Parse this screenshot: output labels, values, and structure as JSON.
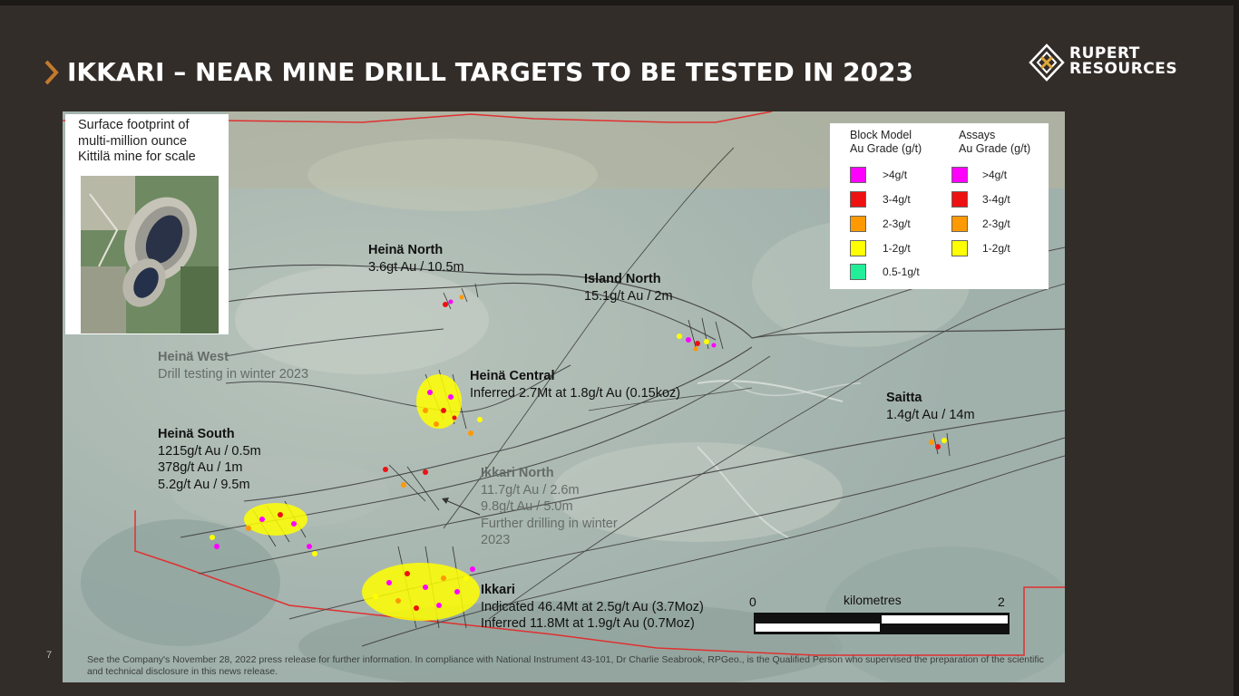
{
  "slide": {
    "title": "IKKARI – NEAR MINE DRILL TARGETS TO BE TESTED IN 2023",
    "page_number": "7",
    "footnote": "See the Company's November 28, 2022 press release for further information. In compliance with National Instrument 43-101, Dr Charlie Seabrook, RPGeo., is the Qualified Person who supervised the preparation of the scientific and technical disclosure in this news release."
  },
  "logo": {
    "line1": "RUPERT",
    "line2": "RESOURCES"
  },
  "inset": {
    "caption_line1": "Surface footprint of",
    "caption_line2": "multi-million ounce",
    "caption_line3": "Kittilä mine for scale"
  },
  "targets": {
    "heina_north": {
      "name": "Heinä North",
      "line1": "3.6gt Au / 10.5m"
    },
    "island_north": {
      "name": "Island North",
      "line1": "15.1g/t Au / 2m"
    },
    "heina_west": {
      "name": "Heinä West",
      "line1": "Drill testing in winter 2023"
    },
    "heina_central": {
      "name": "Heinä Central",
      "line1": "Inferred 2.7Mt at 1.8g/t Au (0.15koz)"
    },
    "saitta": {
      "name": "Saitta",
      "line1": "1.4g/t Au / 14m"
    },
    "heina_south": {
      "name": "Heinä South",
      "line1": "1215g/t Au / 0.5m",
      "line2": "378g/t Au / 1m",
      "line3": "5.2g/t Au / 9.5m"
    },
    "ikkari_north": {
      "name": "Ikkari North",
      "line1": "11.7g/t Au / 2.6m",
      "line2": "9.8g/t Au / 5.0m",
      "line3": "Further drilling in winter",
      "line4": "2023"
    },
    "ikkari": {
      "name": "Ikkari",
      "line1": "Indicated 46.4Mt at 2.5g/t Au (3.7Moz)",
      "line2": "Inferred 11.8Mt at 1.9g/t Au (0.7Moz)"
    }
  },
  "legend": {
    "block_model_title_1": "Block Model",
    "block_model_title_2": "Au Grade (g/t)",
    "assays_title_1": "Assays",
    "assays_title_2": "Au Grade (g/t)",
    "block_model_items": [
      {
        "label": ">4g/t",
        "color": "#ff00ff"
      },
      {
        "label": "3-4g/t",
        "color": "#ee1111"
      },
      {
        "label": "2-3g/t",
        "color": "#ff9900"
      },
      {
        "label": "1-2g/t",
        "color": "#ffff00"
      },
      {
        "label": "0.5-1g/t",
        "color": "#22ee99"
      }
    ],
    "assay_items": [
      {
        "label": ">4g/t",
        "color": "#ff00ff"
      },
      {
        "label": "3-4g/t",
        "color": "#ee1111"
      },
      {
        "label": "2-3g/t",
        "color": "#ff9900"
      },
      {
        "label": "1-2g/t",
        "color": "#ffff00"
      }
    ]
  },
  "scale": {
    "start": "0",
    "end": "2",
    "unit": "kilometres"
  },
  "colors": {
    "background": "#332d29",
    "boundary": "#e03030",
    "accent": "#d9a441"
  }
}
